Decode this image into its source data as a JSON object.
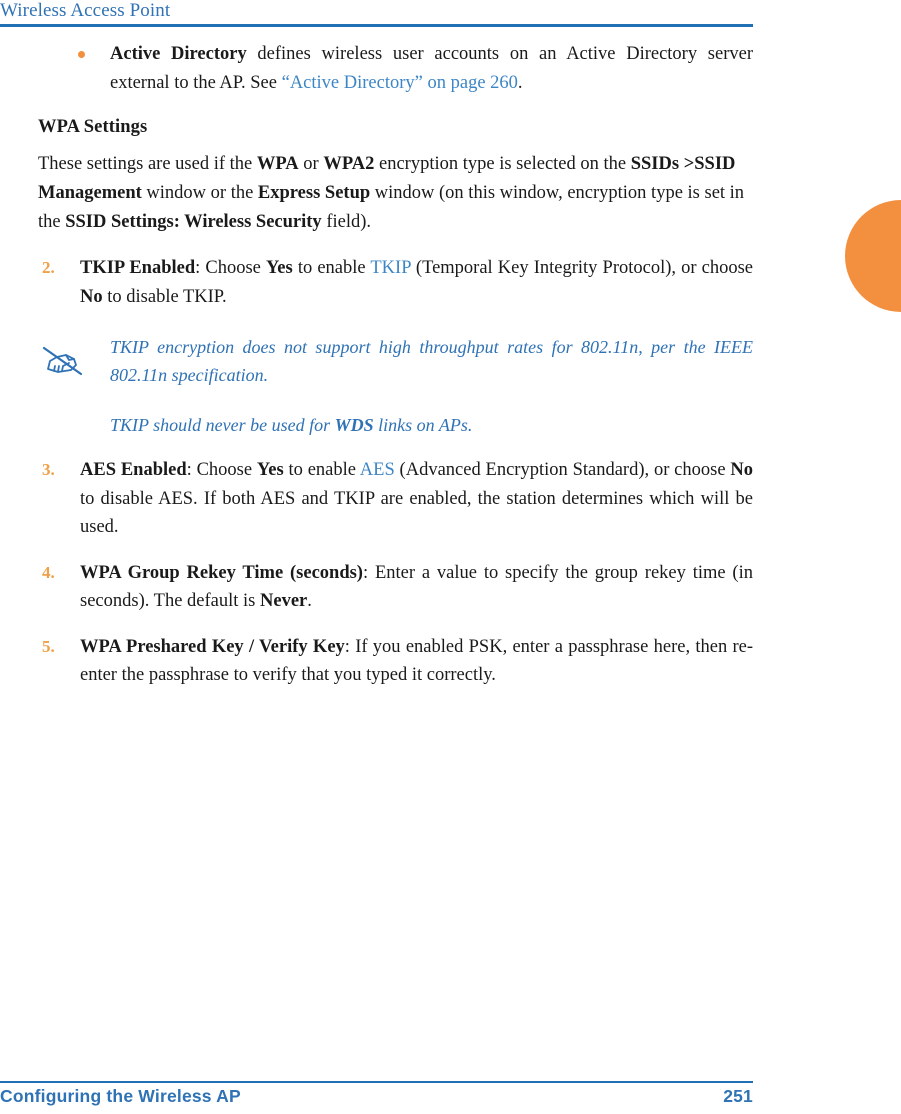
{
  "header": {
    "running_title": "Wireless Access Point",
    "rule_color": "#2170b5"
  },
  "thumb_tab": {
    "name": "chapter-thumb-tab",
    "color": "#f29040"
  },
  "colors": {
    "link_blue": "#3d86c6",
    "heading_blue": "#2f72b5",
    "accent_orange": "#f29040",
    "list_number_orange": "#f0a048",
    "body_black": "#1a1a1a"
  },
  "body": {
    "bullet_item": {
      "marker": "bullet-dot",
      "term": "Active Directory",
      "text_1": " defines wireless user accounts on an Active Directory server external to the AP. See ",
      "xref": "“Active Directory” on page 260",
      "text_2": "."
    },
    "subhead": "WPA Settings",
    "intro_paragraph": {
      "t1": "These settings are used if the ",
      "b1": "WPA",
      "t2": " or ",
      "b2": "WPA2",
      "t3": " encryption type is selected on the ",
      "b3": "SSIDs >SSID Management",
      "t4": " window or the ",
      "b4": "Express Setup",
      "t5": " window (on this window, encryption type is set in the ",
      "b5": "SSID Settings: Wireless Security",
      "t6": " field)."
    },
    "steps": [
      {
        "number": "2.",
        "term": "TKIP Enabled",
        "t1": ": Choose ",
        "b1": "Yes",
        "t2": " to enable ",
        "link1": "TKIP",
        "t3": " (Temporal Key Integrity Protocol), or choose ",
        "b2": "No",
        "t4": " to disable TKIP."
      },
      {
        "number": "3.",
        "term": "AES Enabled",
        "t1": ": Choose ",
        "b1": "Yes",
        "t2": " to enable ",
        "link1": "AES",
        "t3": " (Advanced Encryption Standard), or choose ",
        "b2": "No",
        "t4": " to disable AES. If both AES and TKIP are enabled, the station determines which will be used."
      },
      {
        "number": "4.",
        "term": "WPA Group Rekey Time (seconds)",
        "t1": ": Enter a value to specify the group rekey time (in seconds). The default is ",
        "b1": "Never",
        "t2": "."
      },
      {
        "number": "5.",
        "term": "WPA Preshared Key / Verify Key",
        "t1": ": If you enabled PSK, enter a passphrase here, then re-enter the passphrase to verify that you typed it correctly."
      }
    ],
    "note": {
      "icon": "note-pencil-hand-icon",
      "line_1": "TKIP encryption does not support high throughput rates for 802.11n, per the IEEE 802.11n specification.",
      "line_2_a": "TKIP should never be used for ",
      "line_2_b": "WDS",
      "line_2_c": " links on APs."
    }
  },
  "footer": {
    "left_label": "Configuring the Wireless AP",
    "page_number": "251"
  }
}
